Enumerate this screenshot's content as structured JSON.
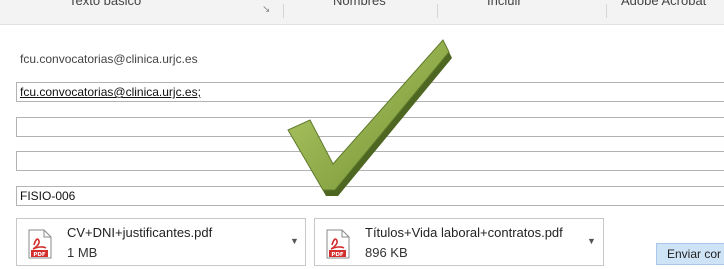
{
  "ribbon": {
    "groups": [
      "Texto básico",
      "Nombres",
      "Incluir",
      "Adobe Acrobat"
    ]
  },
  "compose": {
    "from_account": "fcu.convocatorias@clinica.urjc.es",
    "to_value": "fcu.convocatorias@clinica.urjc.es;",
    "cc_value": "",
    "bcc_value": "",
    "subject_value": "FISIO-006"
  },
  "attachments": [
    {
      "name": "CV+DNI+justificantes.pdf",
      "size": "1 MB",
      "icon": "pdf-file-icon"
    },
    {
      "name": "Títulos+Vida laboral+contratos.pdf",
      "size": "896 KB",
      "icon": "pdf-file-icon"
    }
  ],
  "send_button": "Enviar cor",
  "overlay": {
    "icon": "green-checkmark-icon",
    "color": "#7a9a3a"
  }
}
